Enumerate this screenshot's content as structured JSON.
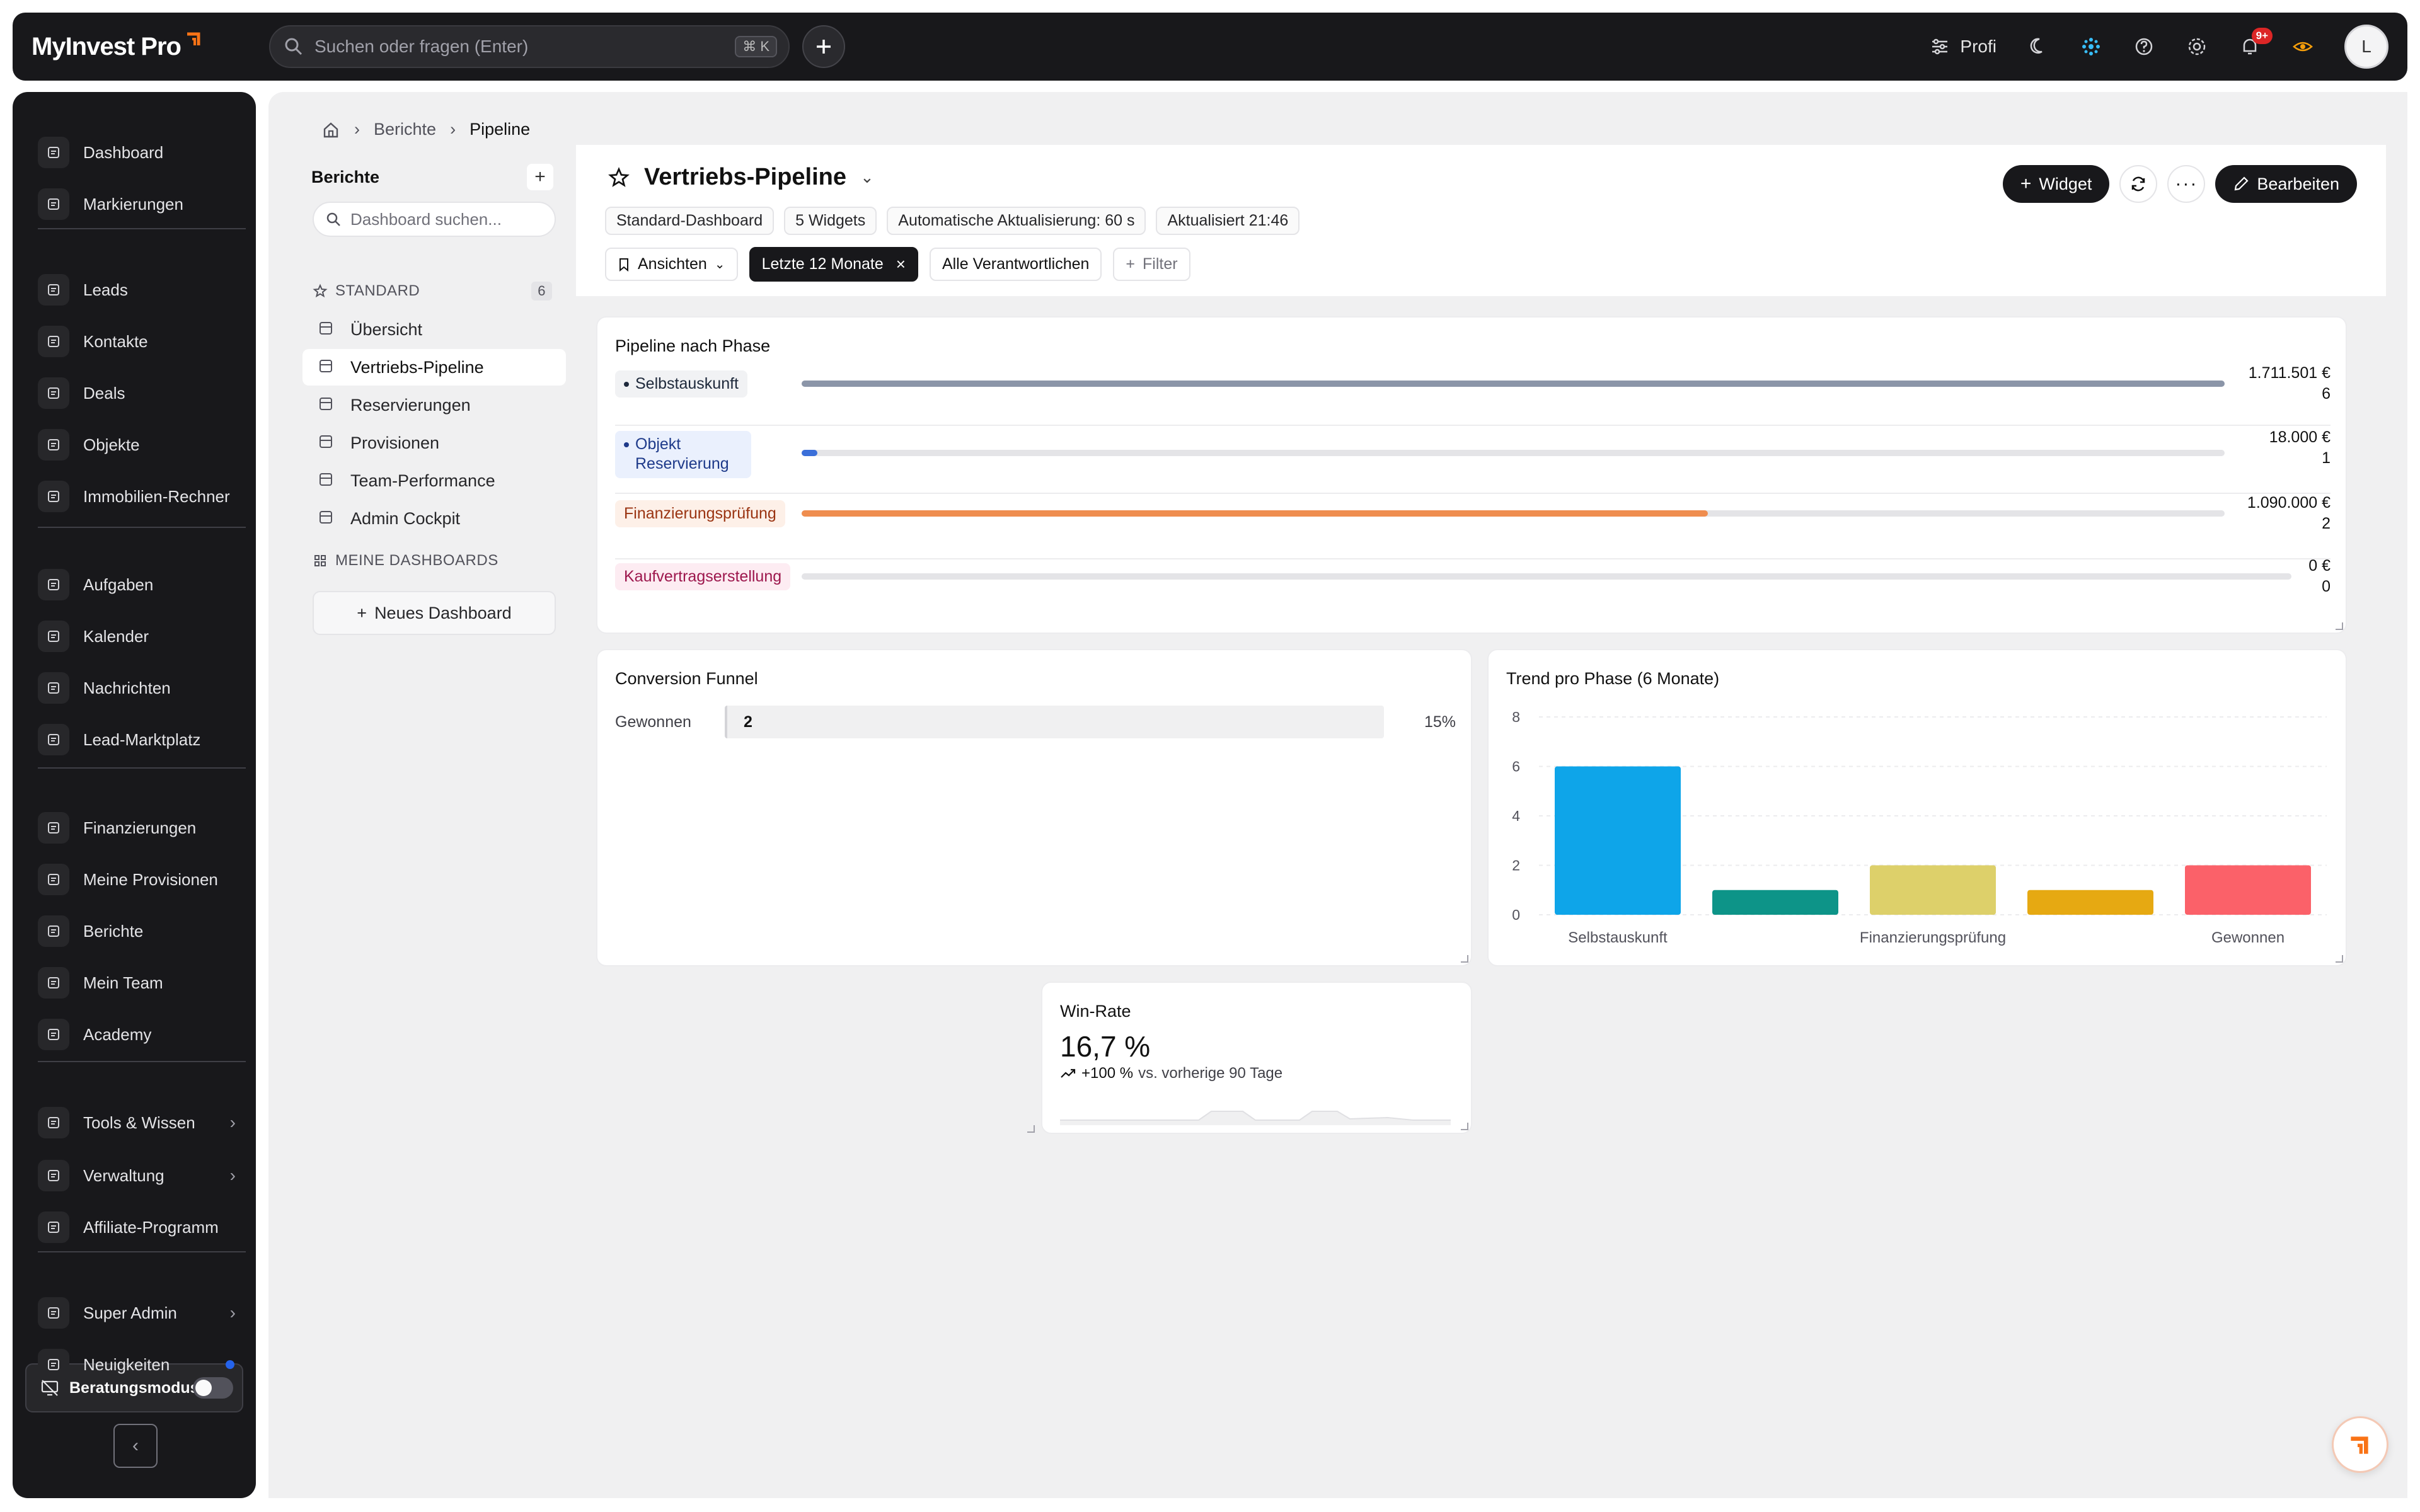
{
  "app": {
    "logo": "MyInvest Pro"
  },
  "topbar": {
    "search_placeholder": "Suchen oder fragen (Enter)",
    "shortcut": "⌘ K",
    "profile_mode": "Profi",
    "notifications_badge": "9+",
    "avatar_initial": "L"
  },
  "sidebar": {
    "groups": [
      [
        {
          "label": "Dashboard",
          "icon": "dashboard-icon"
        },
        {
          "label": "Markierungen",
          "icon": "bookmark-icon"
        }
      ],
      [
        {
          "label": "Leads",
          "icon": "phone-icon"
        },
        {
          "label": "Kontakte",
          "icon": "contact-icon"
        },
        {
          "label": "Deals",
          "icon": "briefcase-icon"
        },
        {
          "label": "Objekte",
          "icon": "building-icon"
        },
        {
          "label": "Immobilien-Rechner",
          "icon": "calculator-icon"
        }
      ],
      [
        {
          "label": "Aufgaben",
          "icon": "task-icon"
        },
        {
          "label": "Kalender",
          "icon": "calendar-icon"
        },
        {
          "label": "Nachrichten",
          "icon": "message-icon"
        },
        {
          "label": "Lead-Marktplatz",
          "icon": "store-icon"
        }
      ],
      [
        {
          "label": "Finanzierungen",
          "icon": "bank-icon"
        },
        {
          "label": "Meine Provisionen",
          "icon": "percent-icon"
        },
        {
          "label": "Berichte",
          "icon": "chart-line-icon"
        },
        {
          "label": "Mein Team",
          "icon": "team-icon"
        },
        {
          "label": "Academy",
          "icon": "graduation-icon"
        }
      ],
      [
        {
          "label": "Tools & Wissen",
          "icon": "tools-icon"
        },
        {
          "label": "Verwaltung",
          "icon": "admin-icon"
        },
        {
          "label": "Affiliate-Programm",
          "icon": "share-icon"
        }
      ],
      [
        {
          "label": "Super Admin",
          "icon": "shield-icon"
        },
        {
          "label": "Neuigkeiten",
          "icon": "megaphone-icon"
        }
      ]
    ],
    "consult_mode": "Beratungsmodus"
  },
  "breadcrumb": [
    "Berichte",
    "Pipeline"
  ],
  "reports_panel": {
    "title": "Berichte",
    "search_placeholder": "Dashboard suchen...",
    "standard_group": "STANDARD",
    "standard_count": "6",
    "items": [
      "Übersicht",
      "Vertriebs-Pipeline",
      "Reservierungen",
      "Provisionen",
      "Team-Performance",
      "Admin Cockpit"
    ],
    "my_group": "MEINE DASHBOARDS",
    "new_dashboard": "Neues Dashboard"
  },
  "dashboard": {
    "title": "Vertriebs-Pipeline",
    "chips": [
      "Standard-Dashboard",
      "5 Widgets",
      "Automatische Aktualisierung: 60 s",
      "Aktualisiert 21:46"
    ],
    "views_label": "Ansichten",
    "period_filter": "Letzte 12 Monate",
    "owner_filter": "Alle Verantwortlichen",
    "add_filter": "Filter",
    "widget_button": "Widget",
    "edit_button": "Bearbeiten"
  },
  "pipeline": {
    "title": "Pipeline nach Phase",
    "rows": [
      {
        "phase": "Selbstauskunft",
        "amount": "1.711.501 €",
        "count": "6",
        "ratio": 1.0,
        "color": "#8b95a8",
        "pill_bg": "#f1f2f4",
        "text_color": "#1e293b",
        "dot": true
      },
      {
        "phase": "Objekt Reservierung",
        "amount": "18.000 €",
        "count": "1",
        "ratio": 0.011,
        "color": "#3b6fd9",
        "pill_bg": "#eaf0fd",
        "text_color": "#1e3a8a",
        "dot": true
      },
      {
        "phase": "Finanzierungsprüfung",
        "amount": "1.090.000 €",
        "count": "2",
        "ratio": 0.637,
        "color": "#ef8d4f",
        "pill_bg": "#fdf0e8",
        "text_color": "#9a3412",
        "dot": false
      },
      {
        "phase": "Kaufvertragserstellung",
        "amount": "0 €",
        "count": "0",
        "ratio": 0,
        "color": "#e4e4e7",
        "pill_bg": "#fdecf2",
        "text_color": "#9d174d",
        "dot": false
      }
    ]
  },
  "funnel": {
    "title": "Conversion Funnel",
    "rows": [
      {
        "label": "Gewonnen",
        "value": "2",
        "pct": "15%"
      }
    ]
  },
  "trend": {
    "title": "Trend pro Phase (6 Monate)"
  },
  "winrate": {
    "title": "Win-Rate",
    "value": "16,7 %",
    "change": "+100 %",
    "compare": "vs. vorherige 90 Tage"
  },
  "chart_data": {
    "type": "bar",
    "title": "Trend pro Phase (6 Monate)",
    "categories": [
      "Selbstauskunft",
      "Objekt Reservierung",
      "Finanzierungsprüfung",
      "Kaufvertragserstellung",
      "Gewonnen"
    ],
    "tick_labels_shown": [
      "Selbstauskunft",
      "Finanzierungsprüfung",
      "Gewonnen"
    ],
    "values": [
      6,
      1,
      2,
      1,
      2
    ],
    "colors": [
      "#0ea5e9",
      "#0d9488",
      "#ddd06a",
      "#e6a912",
      "#fb6169"
    ],
    "yticks": [
      0,
      2,
      4,
      6,
      8
    ],
    "ylim": [
      0,
      8
    ],
    "grid": true
  }
}
